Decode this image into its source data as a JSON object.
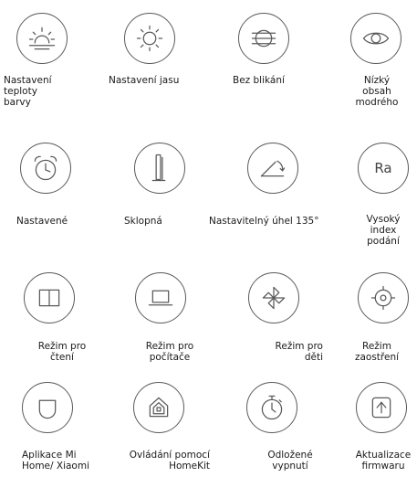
{
  "features": [
    {
      "id": "color_temp",
      "icon": "sunrise-icon",
      "label": "Nastavení\nteploty\nbarvy"
    },
    {
      "id": "brightness",
      "icon": "sun-icon",
      "label": "Nastavení jasu"
    },
    {
      "id": "no_flicker",
      "icon": "flicker-free-icon",
      "label": "Bez blikání"
    },
    {
      "id": "low_blue",
      "icon": "eye-icon",
      "label": "Nízký\nobsah\nmodrého"
    },
    {
      "id": "timer_set",
      "icon": "alarm-clock-icon",
      "label": "Nastavené"
    },
    {
      "id": "folding",
      "icon": "lamp-icon",
      "label": "Sklopná"
    },
    {
      "id": "angle",
      "icon": "angle-icon",
      "label": "Nastavitelný úhel 135°"
    },
    {
      "id": "cri",
      "icon": "ra-icon",
      "icon_text": "Ra",
      "label": "Vysoký\nindex\npodání"
    },
    {
      "id": "reading",
      "icon": "book-icon",
      "label": "Režim pro\nčtení"
    },
    {
      "id": "computer",
      "icon": "laptop-icon",
      "label": "Režim pro\npočítače"
    },
    {
      "id": "kids",
      "icon": "pinwheel-icon",
      "label": "Režim pro\nděti"
    },
    {
      "id": "focus",
      "icon": "focus-icon",
      "label": "Režim\nzaostření"
    },
    {
      "id": "mi_home",
      "icon": "mi-home-icon",
      "label": "Aplikace Mi\nHome/ Xiaomi"
    },
    {
      "id": "homekit",
      "icon": "homekit-icon",
      "label": "Ovládání pomocí\nHomeKit"
    },
    {
      "id": "sleep_timer",
      "icon": "stopwatch-icon",
      "label": "Odložené\nvypnutí"
    },
    {
      "id": "firmware",
      "icon": "firmware-update-icon",
      "label": "Aktualizace\nfirmwaru"
    }
  ],
  "colors": {
    "stroke": "#5a5a5a",
    "text": "#1a1a1a",
    "background": "#ffffff"
  }
}
